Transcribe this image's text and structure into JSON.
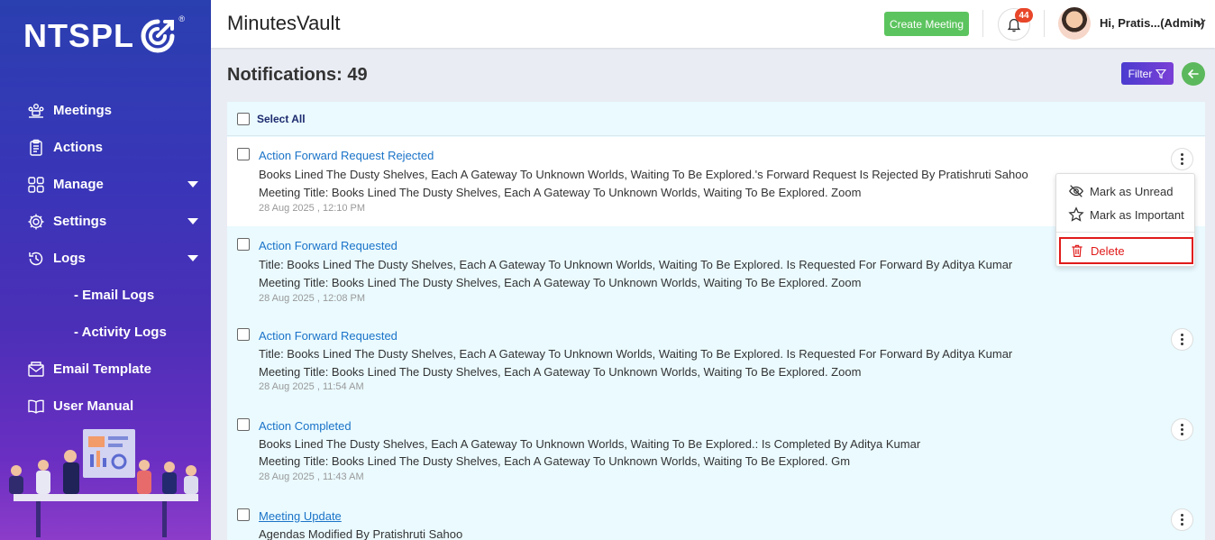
{
  "brand": {
    "logo_text": "NTSPL",
    "reg_mark": "®"
  },
  "app": {
    "title": "MinutesVault"
  },
  "topbar": {
    "create_meeting": "Create Meeting",
    "notification_badge": "44",
    "user_greeting": "Hi, Pratis...(Admin)"
  },
  "sidebar": {
    "items": [
      {
        "label": "Meetings",
        "icon": "meetings-icon"
      },
      {
        "label": "Actions",
        "icon": "clipboard-icon"
      },
      {
        "label": "Manage",
        "icon": "grid-icon",
        "expandable": true
      },
      {
        "label": "Settings",
        "icon": "gear-icon",
        "expandable": true
      },
      {
        "label": "Logs",
        "icon": "history-icon",
        "expandable": true
      },
      {
        "label": "- Email Logs"
      },
      {
        "label": "- Activity Logs"
      },
      {
        "label": "Email Template",
        "icon": "mail-icon"
      },
      {
        "label": "User Manual",
        "icon": "book-icon"
      }
    ]
  },
  "page": {
    "heading": "Notifications: 49",
    "filter_label": "Filter",
    "select_all": "Select All"
  },
  "notifications": [
    {
      "title": "Action Forward Request Rejected",
      "line1": "Books Lined The Dusty Shelves, Each A Gateway To Unknown Worlds, Waiting To Be Explored.'s Forward Request Is Rejected By Pratishruti Sahoo",
      "line2": "Meeting Title: Books Lined The Dusty Shelves, Each A Gateway To Unknown Worlds, Waiting To Be Explored. Zoom",
      "time": "28 Aug 2025 , 12:10 PM"
    },
    {
      "title": "Action Forward Requested",
      "line1": "Title: Books Lined The Dusty Shelves, Each A Gateway To Unknown Worlds, Waiting To Be Explored. Is Requested For Forward By Aditya Kumar",
      "line2": "Meeting Title: Books Lined The Dusty Shelves, Each A Gateway To Unknown Worlds, Waiting To Be Explored. Zoom",
      "time": "28 Aug 2025 , 12:08 PM"
    },
    {
      "title": "Action Forward Requested",
      "line1": "Title: Books Lined The Dusty Shelves, Each A Gateway To Unknown Worlds, Waiting To Be Explored. Is Requested For Forward By Aditya Kumar",
      "line2": "Meeting Title: Books Lined The Dusty Shelves, Each A Gateway To Unknown Worlds, Waiting To Be Explored. Zoom",
      "time": "28 Aug 2025 , 11:54 AM"
    },
    {
      "title": "Action Completed",
      "line1": "Books Lined The Dusty Shelves, Each A Gateway To Unknown Worlds, Waiting To Be Explored.: Is Completed By Aditya Kumar",
      "line2": "Meeting Title: Books Lined The Dusty Shelves, Each A Gateway To Unknown Worlds, Waiting To Be Explored. Gm",
      "time": "28 Aug 2025 , 11:43 AM"
    },
    {
      "title": "Meeting Update",
      "line1": "Agendas Modified By Pratishruti Sahoo"
    }
  ],
  "menu": {
    "mark_unread": "Mark as Unread",
    "mark_important": "Mark as Important",
    "delete": "Delete"
  },
  "colors": {
    "accent_link": "#1a73c8",
    "create_button": "#5cc45e",
    "badge": "#e8462a",
    "delete_highlight": "#e01a1a"
  }
}
